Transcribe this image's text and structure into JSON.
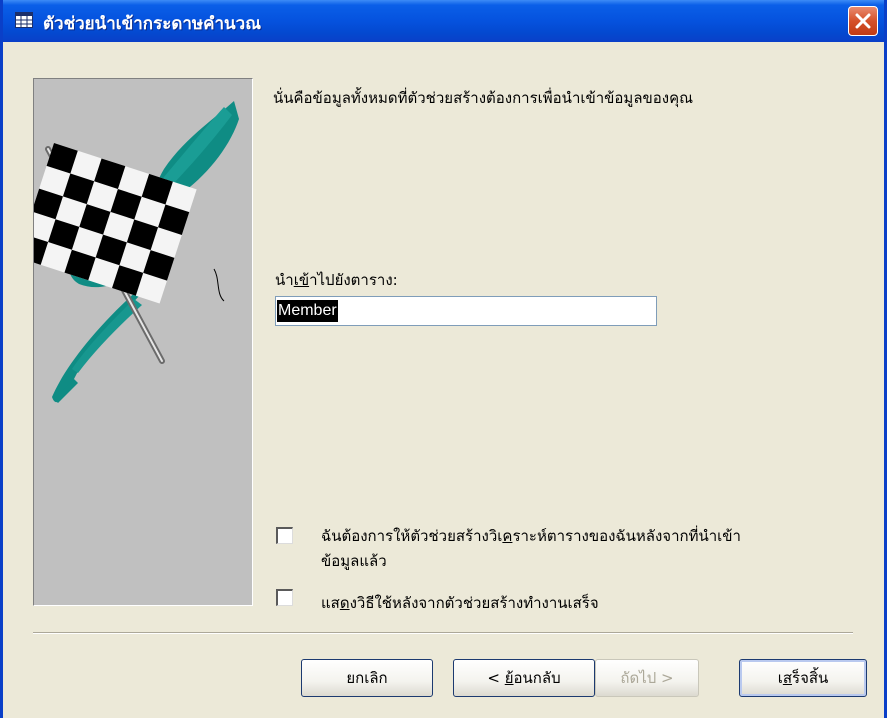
{
  "window": {
    "title": "ตัวช่วยนำเข้ากระดาษคำนวณ"
  },
  "main": {
    "intro_text": "นั่นคือข้อมูลทั้งหมดที่ตัวช่วยสร้างต้องการเพื่อนำเข้าข้อมูลของคุณ",
    "import_label_pre": "นำ",
    "import_label_access": "เข้",
    "import_label_post": "าไปยังตาราง:",
    "table_name_value": "Member"
  },
  "options": {
    "analyze_checked": false,
    "analyze_line1_pre": "ฉันต้องการให้ตัวช่วยสร้างวิเ",
    "analyze_line1_access": "ค",
    "analyze_line1_post": "ราะห์ตารางของฉันหลังจากที่นำเข้า",
    "analyze_line2": "ข้อมูลแล้ว",
    "help_checked": false,
    "help_label_pre": "แส",
    "help_label_access": "ด",
    "help_label_post": "งวิธีใช้หลังจากตัวช่วยสร้างทำงานเสร็จ"
  },
  "buttons": {
    "cancel": "ยกเลิก",
    "back_pre": "< ",
    "back_access": "ย้",
    "back_post": "อนกลับ",
    "next": "ถัดไป >",
    "finish_pre": "เ",
    "finish_access": "ส",
    "finish_post": "ร็จสิ้น"
  }
}
